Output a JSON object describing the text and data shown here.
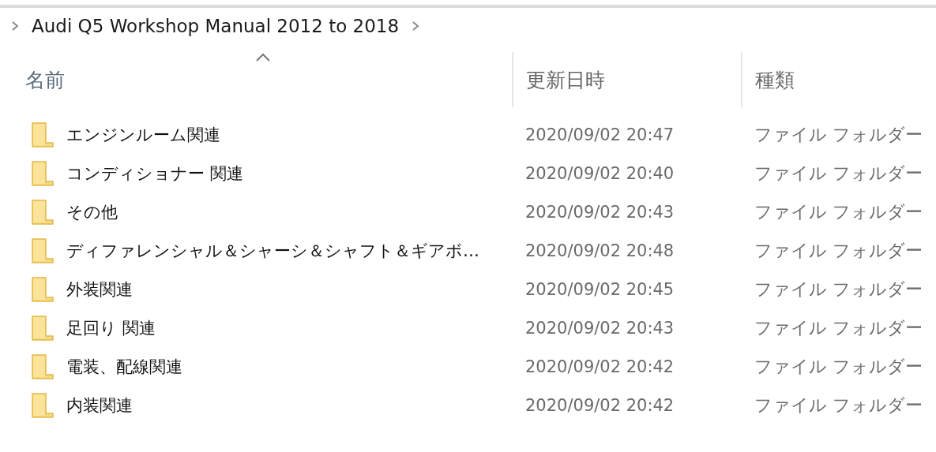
{
  "breadcrumb": {
    "items": [
      "Audi Q5 Workshop Manual 2012 to 2018"
    ]
  },
  "table": {
    "columns": [
      {
        "label": "名前",
        "sorted": true
      },
      {
        "label": "更新日時",
        "sorted": false
      },
      {
        "label": "種類",
        "sorted": false
      }
    ],
    "rows": [
      {
        "name": "エンジンルーム関連",
        "modified": "2020/09/02 20:47",
        "type": "ファイル フォルダー"
      },
      {
        "name": "コンディショナー 関連",
        "modified": "2020/09/02 20:40",
        "type": "ファイル フォルダー"
      },
      {
        "name": "その他",
        "modified": "2020/09/02 20:43",
        "type": "ファイル フォルダー"
      },
      {
        "name": "ディファレンシャル＆シャーシ＆シャフト＆ギアボ…",
        "modified": "2020/09/02 20:48",
        "type": "ファイル フォルダー"
      },
      {
        "name": "外装関連",
        "modified": "2020/09/02 20:45",
        "type": "ファイル フォルダー"
      },
      {
        "name": "足回り 関連",
        "modified": "2020/09/02 20:43",
        "type": "ファイル フォルダー"
      },
      {
        "name": "電装、配線関連",
        "modified": "2020/09/02 20:42",
        "type": "ファイル フォルダー"
      },
      {
        "name": "内装関連",
        "modified": "2020/09/02 20:42",
        "type": "ファイル フォルダー"
      }
    ]
  }
}
